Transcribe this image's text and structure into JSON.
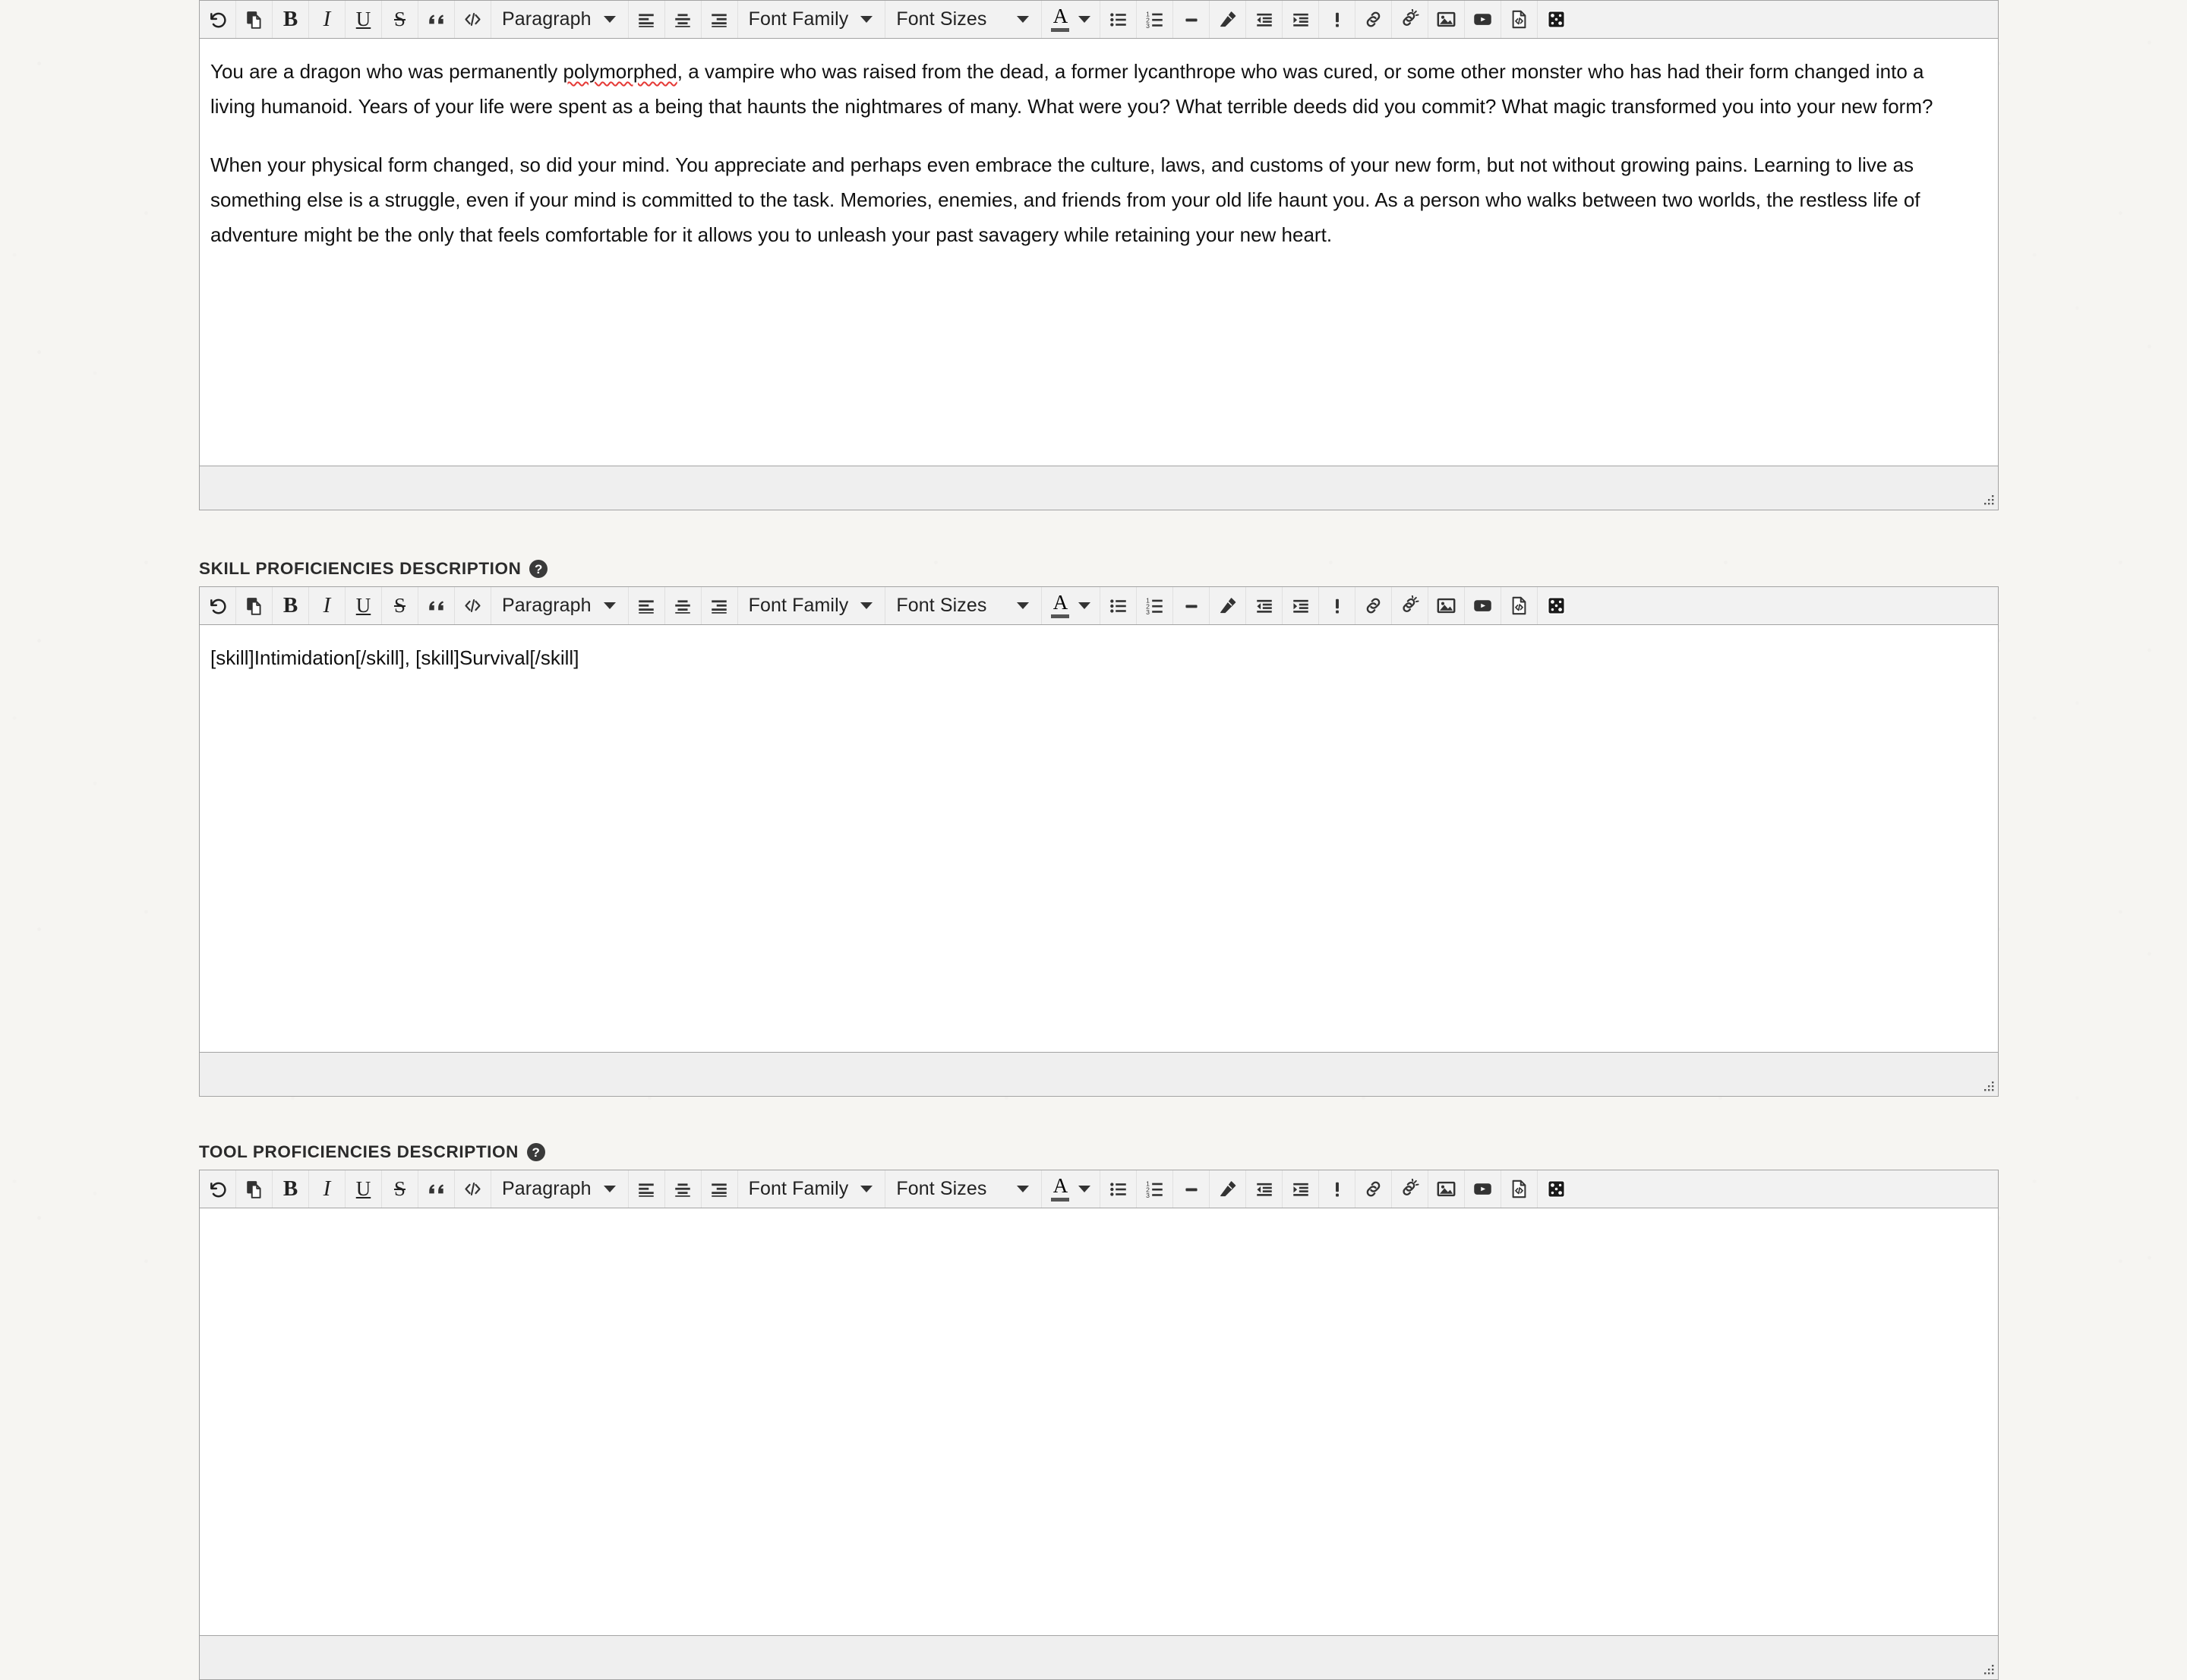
{
  "theme": {
    "page_background": "#f6f5f2",
    "toolbar_background": "#f2f2f2",
    "editor_border": "#a3a3a3",
    "status_background": "#efefef",
    "text_color": "#111111",
    "label_color": "#2b2b2b",
    "spellcheck_underline": "#e53935",
    "help_icon_background": "#3a3a3a"
  },
  "toolbar": {
    "buttons": [
      {
        "name": "undo-icon",
        "label": "Undo"
      },
      {
        "name": "paste-icon",
        "label": "Paste"
      },
      {
        "name": "bold-icon",
        "label": "Bold"
      },
      {
        "name": "italic-icon",
        "label": "Italic"
      },
      {
        "name": "underline-icon",
        "label": "Underline"
      },
      {
        "name": "strikethrough-icon",
        "label": "Strikethrough"
      },
      {
        "name": "blockquote-icon",
        "label": "Blockquote"
      },
      {
        "name": "code-icon",
        "label": "Code"
      }
    ],
    "block_format": {
      "label": "Paragraph",
      "name": "block-format-select"
    },
    "align_buttons": [
      {
        "name": "align-left-icon",
        "label": "Align left"
      },
      {
        "name": "align-center-icon",
        "label": "Align center"
      },
      {
        "name": "align-right-icon",
        "label": "Align right"
      }
    ],
    "font_family": {
      "label": "Font Family",
      "name": "font-family-select"
    },
    "font_sizes": {
      "label": "Font Sizes",
      "name": "font-sizes-select"
    },
    "text_color": {
      "name": "text-color-button",
      "label": "A"
    },
    "list_buttons": [
      {
        "name": "bullet-list-icon",
        "label": "Bulleted list"
      },
      {
        "name": "numbered-list-icon",
        "label": "Numbered list"
      },
      {
        "name": "horizontal-rule-icon",
        "label": "Horizontal rule"
      },
      {
        "name": "remove-format-icon",
        "label": "Remove formatting"
      },
      {
        "name": "outdent-icon",
        "label": "Decrease indent"
      },
      {
        "name": "indent-icon",
        "label": "Increase indent"
      }
    ],
    "insert_buttons": [
      {
        "name": "exclamation-icon",
        "label": "Special character"
      },
      {
        "name": "link-icon",
        "label": "Insert link"
      },
      {
        "name": "unlink-icon",
        "label": "Remove link"
      },
      {
        "name": "image-icon",
        "label": "Insert image"
      },
      {
        "name": "video-icon",
        "label": "Insert video"
      },
      {
        "name": "source-code-icon",
        "label": "Source code"
      },
      {
        "name": "dice-icon",
        "label": "Insert dice roll"
      }
    ]
  },
  "sections": [
    {
      "id": "background-description",
      "label": "",
      "has_label": false,
      "paragraphs": [
        {
          "runs": [
            {
              "text": "You are a dragon who was permanently ",
              "spellcheck_error": false
            },
            {
              "text": "polymorphed",
              "spellcheck_error": true
            },
            {
              "text": ", a vampire who was raised from the dead, a former lycanthrope who was cured, or some other monster who has had their form changed into a living humanoid. Years of your life were spent as a being that haunts the nightmares of many. What were you? What terrible deeds did you commit? What magic transformed you into your new form?",
              "spellcheck_error": false
            }
          ]
        },
        {
          "runs": [
            {
              "text": "When your physical form changed, so did your mind. You appreciate and perhaps even embrace the culture, laws, and customs of your new form, but not without growing pains. Learning to live as something else is a struggle, even if your mind is committed to the task. Memories, enemies, and friends from your old life haunt you. As a person who walks between two worlds, the restless life of adventure might be the only that feels comfortable for it allows you to unleash your past savagery while retaining your new heart.",
              "spellcheck_error": false
            }
          ]
        }
      ]
    },
    {
      "id": "skill-proficiencies-description",
      "label": "SKILL PROFICIENCIES DESCRIPTION",
      "has_label": true,
      "paragraphs": [
        {
          "runs": [
            {
              "text": "[skill]Intimidation[/skill], [skill]Survival[/skill]",
              "spellcheck_error": false
            }
          ]
        }
      ]
    },
    {
      "id": "tool-proficiencies-description",
      "label": "TOOL PROFICIENCIES DESCRIPTION",
      "has_label": true,
      "paragraphs": []
    }
  ],
  "help_icon_glyph": "?"
}
